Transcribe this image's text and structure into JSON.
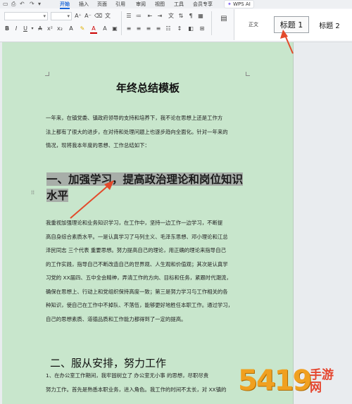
{
  "ribbon": {
    "tabs": [
      "开始",
      "插入",
      "页面",
      "引用",
      "审阅",
      "视图",
      "工具",
      "会员专享"
    ],
    "active_tab": "开始",
    "wps_ai": "WPS AI",
    "font_name": "",
    "font_size": "",
    "styles": {
      "normal": "正文",
      "heading1": "标题 1",
      "heading2": "标题 2"
    }
  },
  "document": {
    "title": "年终总结模板",
    "intro": [
      "一年来，在镇党委、镇政府领导的支持和培养下，我不论在思想上还是工作方",
      "法上都有了很大的进步，在对待和处理问题上也逐步趋向全面化。针对一年来的",
      "情况，现将我本年度的思想、工作总结如下："
    ],
    "heading1_line1": "一、加强学习，提高政治理论和岗位知识",
    "heading1_line2": "水平",
    "body": [
      "我重视加强理论和业务知识学习，在工作中，坚持一边工作一边学习，不断提",
      "高自身综合素质水平。一是认真学习了马列主义、毛泽东思想、邓小理论和江总",
      "泽民同志  三个代表  重要思想。努力提高自己的理论，用正确的理论来指导自己",
      "的工作实践，指导自己不断改造自己的世界观、人生观和价值观；其次是认真学",
      "习党的 XX届四、五中全会精神，弄清工作的方向、目标和任务，紧跟时代潮流，",
      "确保在思想上、行动上和党组织保持高度一致；第三是努力学习与工作相关的各",
      "种知识，使自己在工作中不掉队、不落伍，能够更好地胜任本职工作。通过学习，",
      "自己的思想素质、道德品质和工作能力都得到了一定的提高。"
    ],
    "heading2": "二、服从安排，努力工作",
    "body2": [
      "1、在办公室工作期间，我牢固树立了  办公室无小事  的思想，尽职尽责",
      "努力工作。首先是熟悉本职业务，进入角色。我工作的时间不太长，对 XX镇的"
    ]
  },
  "watermark": {
    "number": "5419",
    "text_line1": "手游",
    "text_line2": "网",
    "url": ""
  },
  "colors": {
    "page_bg": "#c8e6cc",
    "arrow": "#e34a2b",
    "heading_highlight": "#a8aea9",
    "accent": "#1a66d9"
  }
}
